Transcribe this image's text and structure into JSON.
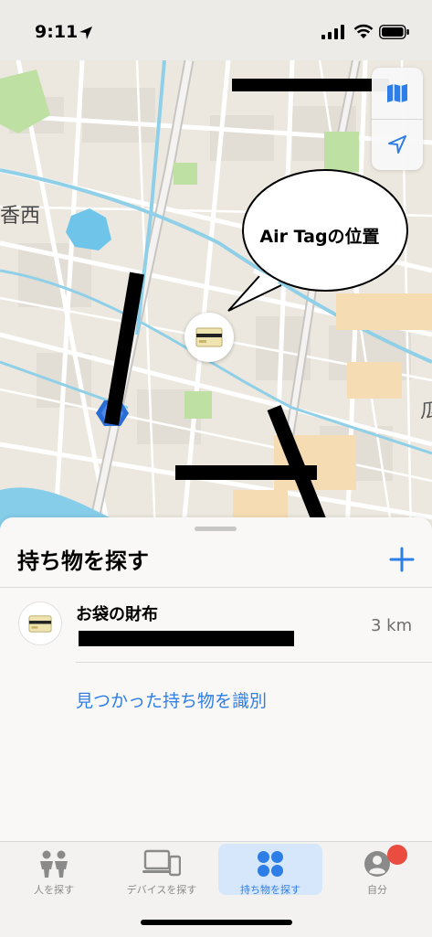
{
  "status_bar": {
    "time": "9:11"
  },
  "map": {
    "labels": {
      "kasai": "香西",
      "right_partial": "瓜"
    },
    "callout": "Air Tagの位置"
  },
  "sheet": {
    "title": "持ち物を探す",
    "items": [
      {
        "name": "お袋の財布",
        "distance": "3 km"
      }
    ],
    "identify_link": "見つかった持ち物を識別"
  },
  "tabs": [
    {
      "label": "人を探す",
      "icon": "people-icon",
      "active": false
    },
    {
      "label": "デバイスを探す",
      "icon": "devices-icon",
      "active": false
    },
    {
      "label": "持ち物を探す",
      "icon": "items-icon",
      "active": true
    },
    {
      "label": "自分",
      "icon": "me-icon",
      "active": false
    }
  ],
  "colors": {
    "accent": "#2d7ee6",
    "badge": "#ea4c3f",
    "tab_active_bg": "#d7e7fb"
  }
}
